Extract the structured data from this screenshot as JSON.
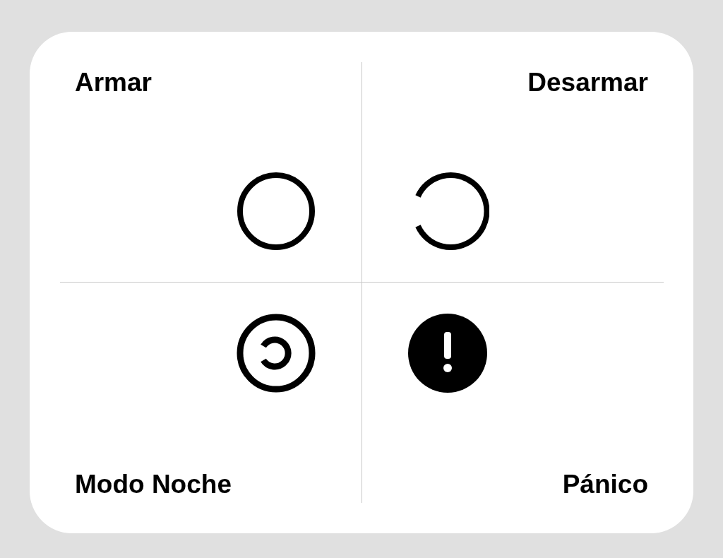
{
  "buttons": [
    {
      "label": "Armar",
      "kind": "arm"
    },
    {
      "label": "Desarmar",
      "kind": "disarm"
    },
    {
      "label": "Modo Noche",
      "kind": "night"
    },
    {
      "label": "Pánico",
      "kind": "panic"
    }
  ]
}
